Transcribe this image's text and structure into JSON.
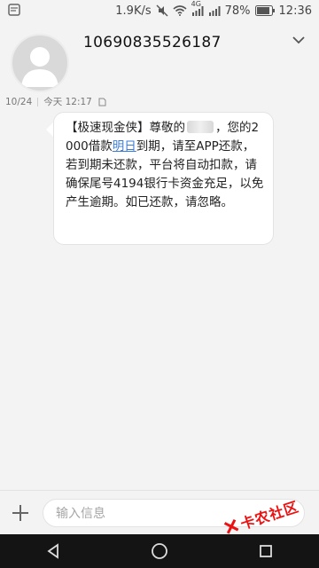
{
  "status_bar": {
    "network_speed": "1.9K/s",
    "signal_label_4g": "4G",
    "battery": "78%",
    "time": "12:36"
  },
  "header": {
    "sender": "10690835526187"
  },
  "meta": {
    "date": "10/24",
    "time": "今天 12:17"
  },
  "message": {
    "part1": "【极速现金侠】尊敬的",
    "part2": "，您的2000借款",
    "link_text": "明日",
    "part3": "到期，请至APP还款，若到期未还款，平台将自动扣款，请确保尾号4194银行卡资金充足，以免产生逾期。如已还款，请忽略。"
  },
  "input": {
    "placeholder": "输入信息"
  },
  "watermark": {
    "text": "卡农社区"
  },
  "colors": {
    "link": "#3a7bd5",
    "navbar": "#141414",
    "watermark": "#e11111"
  }
}
